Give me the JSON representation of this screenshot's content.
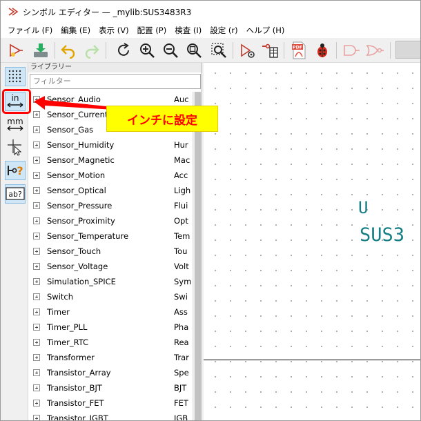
{
  "window": {
    "title": "シンボル エディター — _mylib:SUS3483R3"
  },
  "menu": {
    "items": [
      {
        "label": "ファイル (F)"
      },
      {
        "label": "編集 (E)"
      },
      {
        "label": "表示 (V)"
      },
      {
        "label": "配置 (P)"
      },
      {
        "label": "検査 (I)"
      },
      {
        "label": "設定 (r)"
      },
      {
        "label": "ヘルプ (H)"
      }
    ]
  },
  "toolbar": {
    "pdf_text": "PDF"
  },
  "left_toolbar": {
    "units_in_label": "in",
    "units_mm_label": "mm",
    "pin_unknown_label": "?",
    "text_label": "ab?"
  },
  "library_panel": {
    "header": "ライブラリー",
    "filter_placeholder": "フィルター",
    "items": [
      {
        "name": "Sensor_Audio",
        "desc": "Auc"
      },
      {
        "name": "Sensor_Current",
        "desc": ""
      },
      {
        "name": "Sensor_Gas",
        "desc": ""
      },
      {
        "name": "Sensor_Humidity",
        "desc": "Hur"
      },
      {
        "name": "Sensor_Magnetic",
        "desc": "Mac"
      },
      {
        "name": "Sensor_Motion",
        "desc": "Acc"
      },
      {
        "name": "Sensor_Optical",
        "desc": "Ligh"
      },
      {
        "name": "Sensor_Pressure",
        "desc": "Flui"
      },
      {
        "name": "Sensor_Proximity",
        "desc": "Opt"
      },
      {
        "name": "Sensor_Temperature",
        "desc": "Tem"
      },
      {
        "name": "Sensor_Touch",
        "desc": "Tou"
      },
      {
        "name": "Sensor_Voltage",
        "desc": "Volt"
      },
      {
        "name": "Simulation_SPICE",
        "desc": "Sym"
      },
      {
        "name": "Switch",
        "desc": "Swi"
      },
      {
        "name": "Timer",
        "desc": "Ass"
      },
      {
        "name": "Timer_PLL",
        "desc": "Pha"
      },
      {
        "name": "Timer_RTC",
        "desc": "Rea"
      },
      {
        "name": "Transformer",
        "desc": "Trar"
      },
      {
        "name": "Transistor_Array",
        "desc": "Spe"
      },
      {
        "name": "Transistor_BJT",
        "desc": "BJT"
      },
      {
        "name": "Transistor_FET",
        "desc": "FET"
      },
      {
        "name": "Transistor_IGBT",
        "desc": "IGB"
      }
    ]
  },
  "canvas": {
    "reference": "U",
    "value": "SUS3"
  },
  "annotation": {
    "label": "インチに設定"
  },
  "colors": {
    "symbol_text": "#157d84",
    "annotation_red": "#ff0000",
    "annotation_bg": "#ffff00",
    "active_tool_bg": "#cfe6f7"
  }
}
